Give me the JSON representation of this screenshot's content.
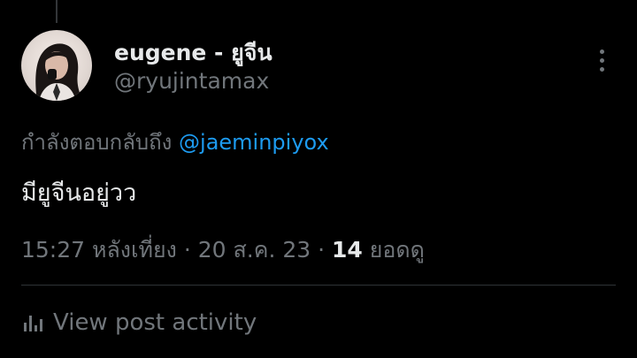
{
  "author": {
    "display_name": "eugene - ยูจีน",
    "handle": "@ryujintamax"
  },
  "reply": {
    "prefix": "กำลังตอบกลับถึง",
    "mention": "@jaeminpiyox"
  },
  "tweet": {
    "text": "มียูจีนอยู่วว"
  },
  "meta": {
    "time": "15:27 หลังเที่ยง",
    "separator": "·",
    "date": "20 ส.ค. 23",
    "views_count": "14",
    "views_label": "ยอดดู"
  },
  "activity": {
    "label": "View post activity",
    "icon": "bar-chart-icon"
  },
  "icons": {
    "more": "more-vertical-icon"
  },
  "colors": {
    "background": "#000000",
    "primary_text": "#e7e9ea",
    "secondary_text": "#71767b",
    "link": "#1d9bf0",
    "divider": "#2f3336"
  }
}
